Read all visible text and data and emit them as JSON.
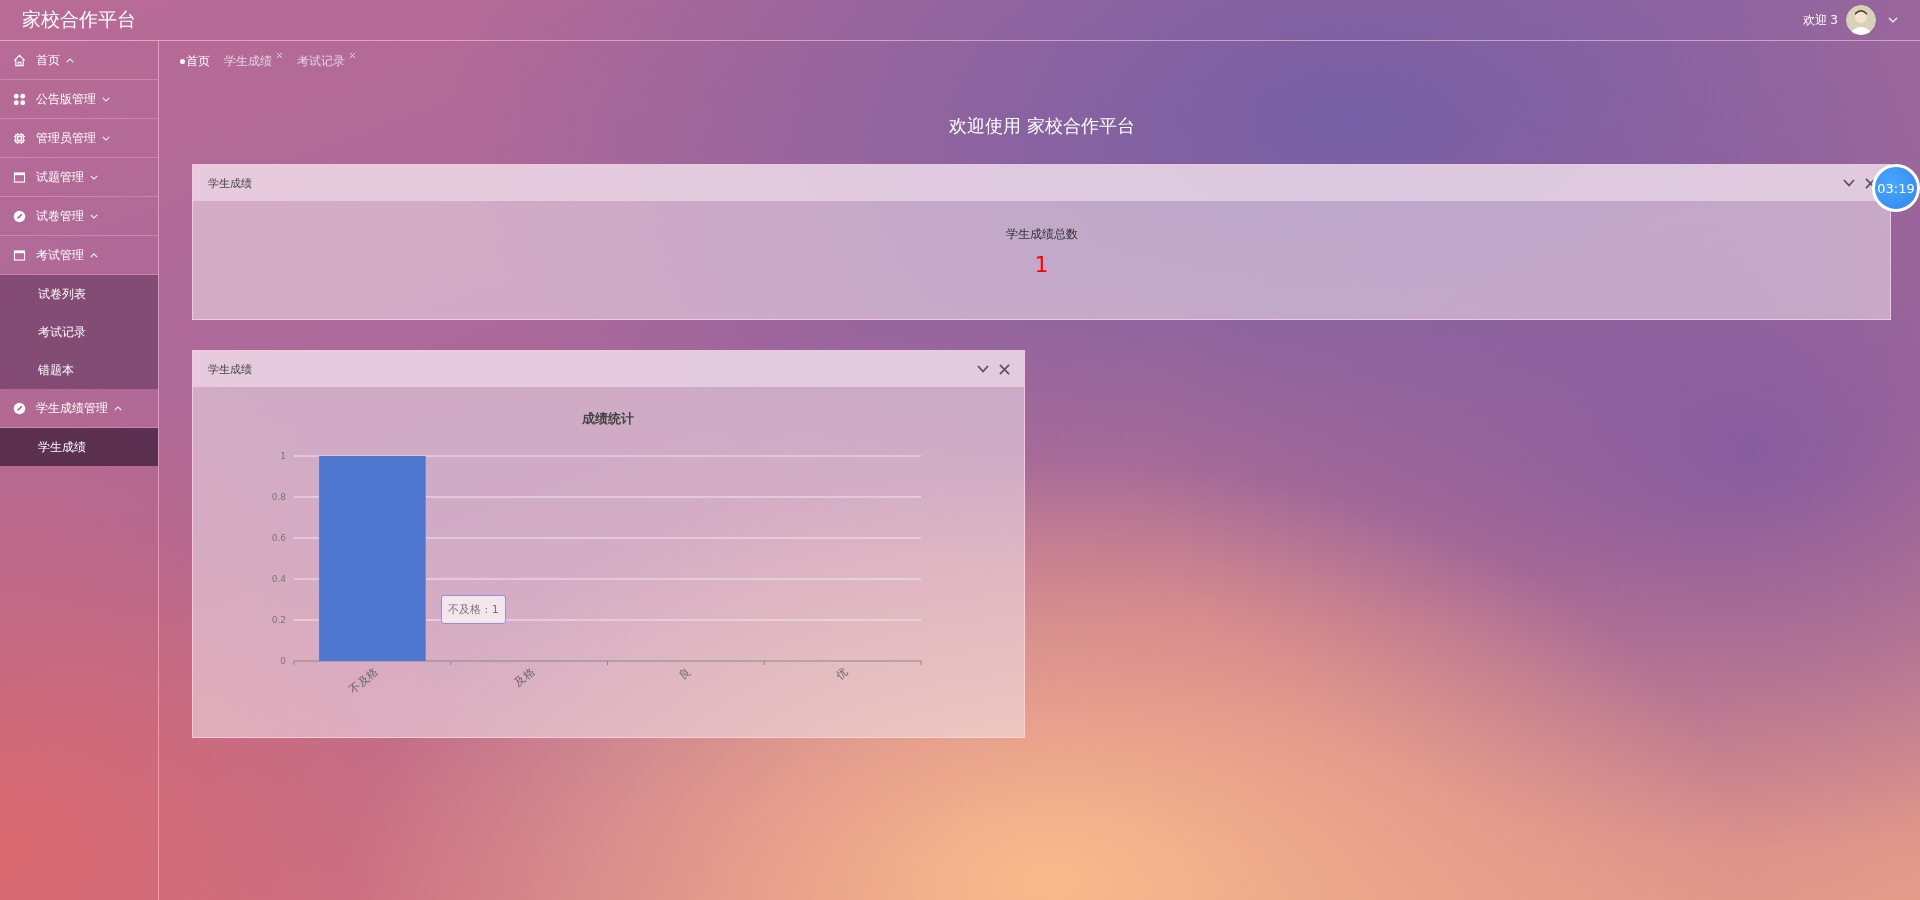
{
  "header": {
    "title": "家校合作平台",
    "greeting": "欢迎 3"
  },
  "sidebar": {
    "items": [
      {
        "label": "首页",
        "expanded": true
      },
      {
        "label": "公告版管理",
        "expanded": false
      },
      {
        "label": "管理员管理",
        "expanded": false
      },
      {
        "label": "试题管理",
        "expanded": false
      },
      {
        "label": "试卷管理",
        "expanded": false
      },
      {
        "label": "考试管理",
        "expanded": true,
        "children": [
          {
            "label": "试卷列表",
            "selected": false
          },
          {
            "label": "考试记录",
            "selected": false
          },
          {
            "label": "错题本",
            "selected": false
          }
        ]
      },
      {
        "label": "学生成绩管理",
        "expanded": true,
        "children": [
          {
            "label": "学生成绩",
            "selected": true
          }
        ]
      }
    ]
  },
  "tabs": [
    {
      "label": "首页",
      "selected": true,
      "closable": false
    },
    {
      "label": "学生成绩",
      "selected": false,
      "closable": true
    },
    {
      "label": "考试记录",
      "selected": false,
      "closable": true
    }
  ],
  "main": {
    "title": "欢迎使用 家校合作平台"
  },
  "cards": [
    {
      "kind": "count",
      "title": "学生成绩",
      "caption": "学生成绩总数",
      "value": "1"
    },
    {
      "kind": "chart",
      "title": "学生成绩",
      "tooltip": "不及格 : 1",
      "chart_data": {
        "type": "bar",
        "title": "成绩统计",
        "categories": [
          "不及格",
          "及格",
          "良",
          "优"
        ],
        "series": [
          {
            "color": "#5077cf",
            "values": [
              1,
              0,
              0,
              0
            ]
          }
        ],
        "grid": true,
        "ylim": [
          0,
          1
        ],
        "yticks": [
          0,
          0.2,
          0.4,
          0.6,
          0.8,
          1
        ]
      }
    }
  ],
  "timer": "03:19"
}
